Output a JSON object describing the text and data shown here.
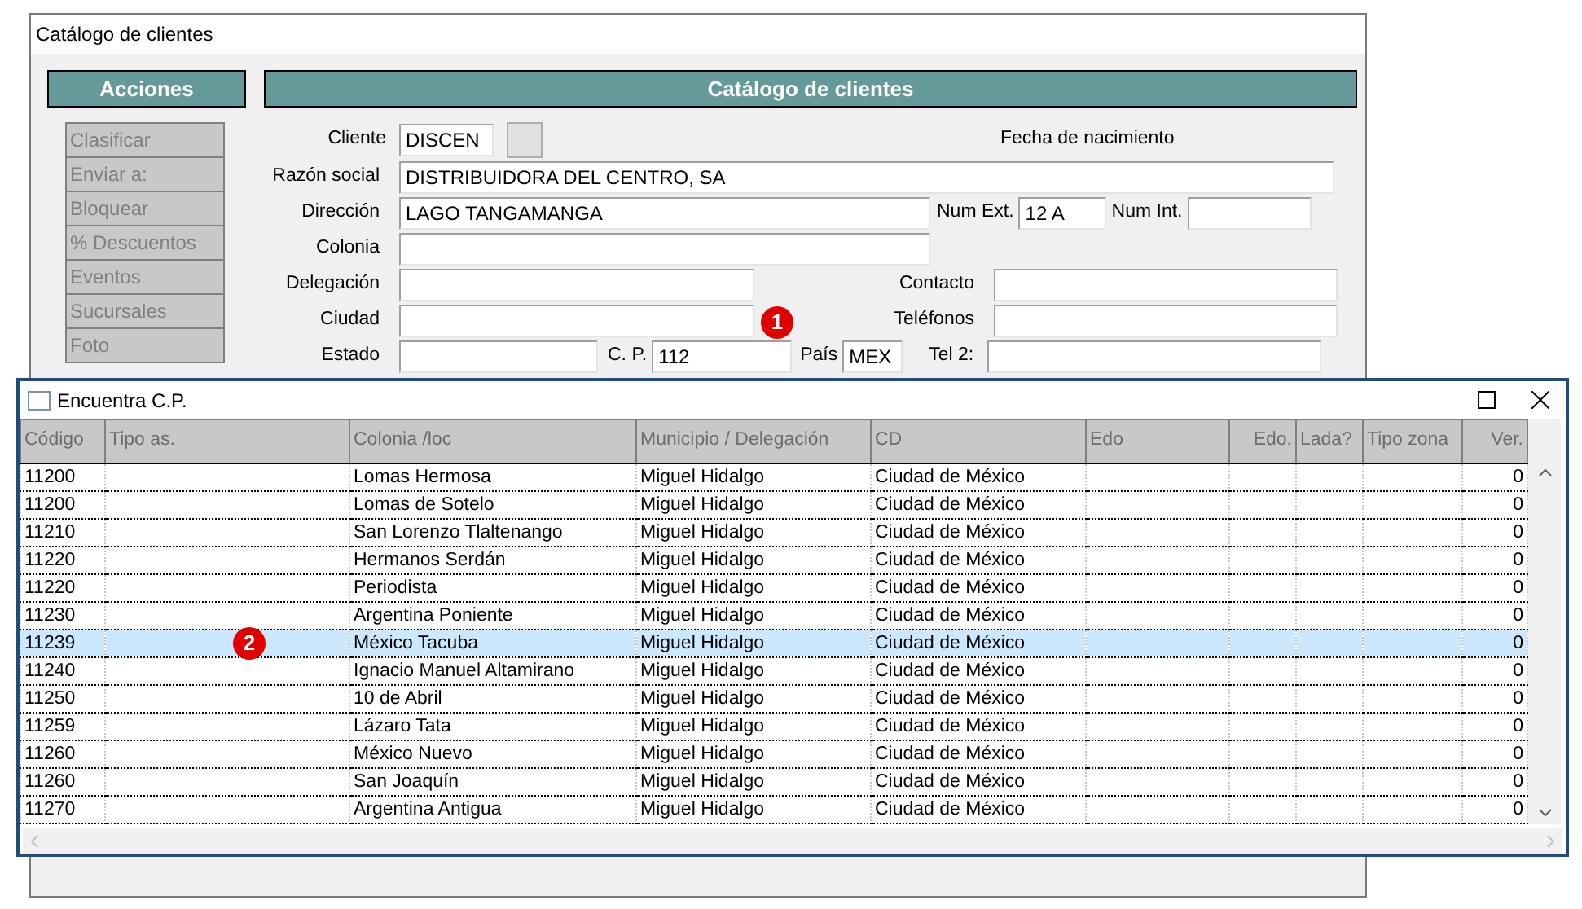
{
  "main_window": {
    "title": "Catálogo de clientes"
  },
  "actions": {
    "title": "Acciones",
    "items": [
      {
        "label": "Clasificar",
        "disabled": true
      },
      {
        "label": "Enviar a:",
        "disabled": true
      },
      {
        "label": "Bloquear",
        "disabled": true
      },
      {
        "label": "% Descuentos",
        "disabled": true
      },
      {
        "label": "Eventos",
        "disabled": true
      },
      {
        "label": "Sucursales",
        "disabled": true
      },
      {
        "label": "Foto",
        "disabled": true
      }
    ]
  },
  "form": {
    "title": "Catálogo de clientes",
    "cliente": {
      "label": "Cliente",
      "value": "DISCEN"
    },
    "fecha_nacimiento": {
      "label": "Fecha de nacimiento"
    },
    "razon_social": {
      "label": "Razón social",
      "value": "DISTRIBUIDORA DEL CENTRO, SA"
    },
    "direccion": {
      "label": "Dirección",
      "value": "LAGO TANGAMANGA"
    },
    "num_ext": {
      "label": "Num Ext.",
      "value": "12 A"
    },
    "num_int": {
      "label": "Num Int."
    },
    "colonia": {
      "label": "Colonia"
    },
    "delegacion": {
      "label": "Delegación"
    },
    "contacto": {
      "label": "Contacto"
    },
    "ciudad": {
      "label": "Ciudad"
    },
    "telefonos": {
      "label": "Teléfonos"
    },
    "estado": {
      "label": "Estado"
    },
    "cp": {
      "label": "C. P.",
      "value": "112"
    },
    "pais": {
      "label": "País",
      "value": "MEX"
    },
    "tel2": {
      "label": "Tel 2:"
    }
  },
  "dialog": {
    "title": "Encuentra C.P.",
    "columns": [
      "Código",
      "Tipo as.",
      "Colonia /loc",
      "Municipio / Delegación",
      "CD",
      "Edo",
      "Edo.",
      "Lada?",
      "Tipo zona",
      "Ver."
    ],
    "rows": [
      {
        "cells": [
          "11200",
          "",
          "Lomas Hermosa",
          "Miguel Hidalgo",
          "Ciudad de México",
          "",
          "",
          "",
          "",
          "0"
        ],
        "selected": false
      },
      {
        "cells": [
          "11200",
          "",
          "Lomas de Sotelo",
          "Miguel Hidalgo",
          "Ciudad de México",
          "",
          "",
          "",
          "",
          "0"
        ],
        "selected": false
      },
      {
        "cells": [
          "11210",
          "",
          "San Lorenzo Tlaltenango",
          "Miguel Hidalgo",
          "Ciudad de México",
          "",
          "",
          "",
          "",
          "0"
        ],
        "selected": false
      },
      {
        "cells": [
          "11220",
          "",
          "Hermanos Serdán",
          "Miguel Hidalgo",
          "Ciudad de México",
          "",
          "",
          "",
          "",
          "0"
        ],
        "selected": false
      },
      {
        "cells": [
          "11220",
          "",
          "Periodista",
          "Miguel Hidalgo",
          "Ciudad de México",
          "",
          "",
          "",
          "",
          "0"
        ],
        "selected": false
      },
      {
        "cells": [
          "11230",
          "",
          "Argentina Poniente",
          "Miguel Hidalgo",
          "Ciudad de México",
          "",
          "",
          "",
          "",
          "0"
        ],
        "selected": false
      },
      {
        "cells": [
          "11239",
          "",
          "México Tacuba",
          "Miguel Hidalgo",
          "Ciudad de México",
          "",
          "",
          "",
          "",
          "0"
        ],
        "selected": true
      },
      {
        "cells": [
          "11240",
          "",
          "Ignacio Manuel Altamirano",
          "Miguel Hidalgo",
          "Ciudad de México",
          "",
          "",
          "",
          "",
          "0"
        ],
        "selected": false
      },
      {
        "cells": [
          "11250",
          "",
          "10 de Abril",
          "Miguel Hidalgo",
          "Ciudad de México",
          "",
          "",
          "",
          "",
          "0"
        ],
        "selected": false
      },
      {
        "cells": [
          "11259",
          "",
          "Lázaro Tata",
          "Miguel Hidalgo",
          "Ciudad de México",
          "",
          "",
          "",
          "",
          "0"
        ],
        "selected": false
      },
      {
        "cells": [
          "11260",
          "",
          "México Nuevo",
          "Miguel Hidalgo",
          "Ciudad de México",
          "",
          "",
          "",
          "",
          "0"
        ],
        "selected": false
      },
      {
        "cells": [
          "11260",
          "",
          "San Joaquín",
          "Miguel Hidalgo",
          "Ciudad de México",
          "",
          "",
          "",
          "",
          "0"
        ],
        "selected": false
      },
      {
        "cells": [
          "11270",
          "",
          "Argentina Antigua",
          "Miguel Hidalgo",
          "Ciudad de México",
          "",
          "",
          "",
          "",
          "0"
        ],
        "selected": false
      }
    ]
  },
  "annotations": [
    "1",
    "2"
  ]
}
